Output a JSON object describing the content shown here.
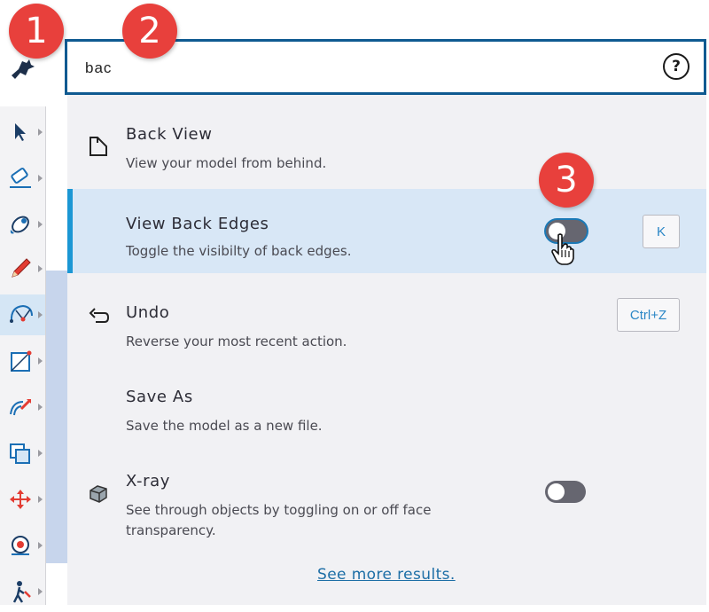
{
  "callouts": [
    "1",
    "2",
    "3"
  ],
  "search": {
    "value": "bac",
    "help_icon": "?"
  },
  "results": [
    {
      "title": "Back View",
      "description": "View your model from behind.",
      "icon": "back-view-icon"
    },
    {
      "title": "View Back Edges",
      "description": "Toggle the visibilty of back edges.",
      "shortcut": "K",
      "toggle": "off"
    },
    {
      "title": "Undo",
      "description": "Reverse your most recent action.",
      "shortcut": "Ctrl+Z",
      "icon": "undo-icon"
    },
    {
      "title": "Save As",
      "description": "Save the model as a new file."
    },
    {
      "title": "X-ray",
      "description": "See through objects by toggling on or off face transparency.",
      "icon": "xray-icon",
      "toggle": "off"
    }
  ],
  "see_more": "See more results.",
  "toolbar": [
    "select-tool",
    "eraser-tool",
    "paint-bucket-tool",
    "pencil-tool",
    "arc-tool",
    "rectangle-tool",
    "push-pull-tool",
    "offset-tool",
    "move-tool",
    "tape-measure-tool",
    "walk-tool"
  ],
  "colors": {
    "accent": "#1b97d4",
    "search_border": "#0f5a91",
    "highlight": "#d8e7f6",
    "callout": "#e8403c",
    "link": "#1d6ea6"
  }
}
